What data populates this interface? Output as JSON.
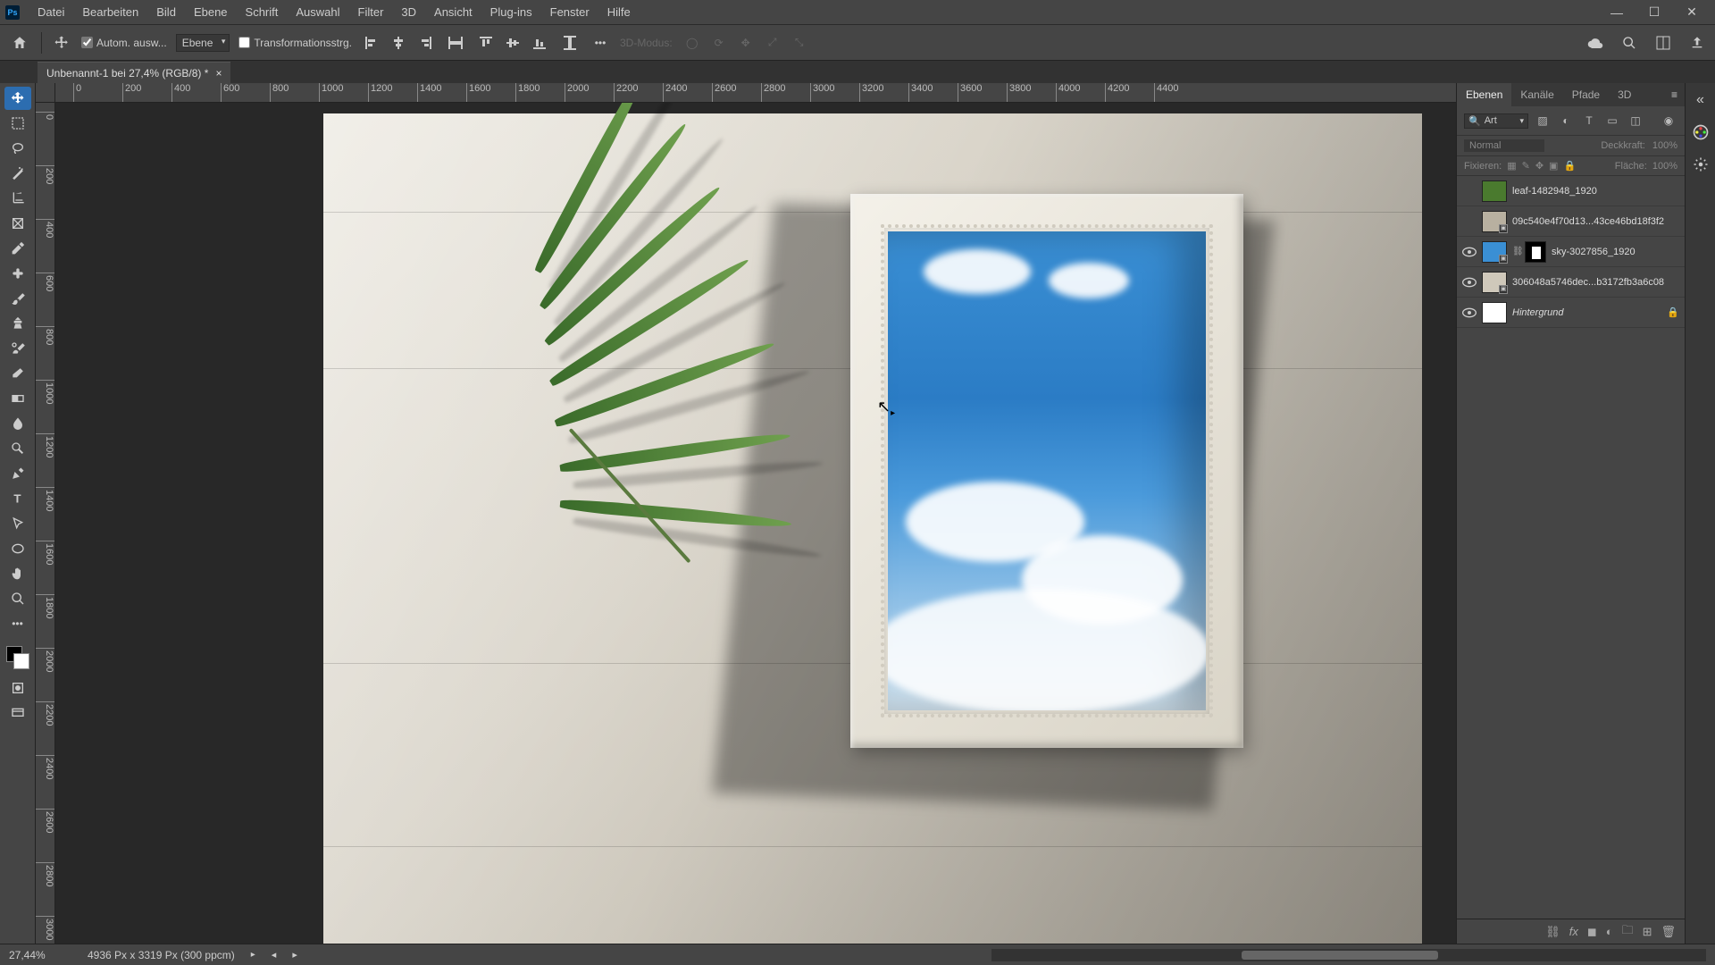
{
  "menubar": {
    "items": [
      "Datei",
      "Bearbeiten",
      "Bild",
      "Ebene",
      "Schrift",
      "Auswahl",
      "Filter",
      "3D",
      "Ansicht",
      "Plug-ins",
      "Fenster",
      "Hilfe"
    ]
  },
  "optionsbar": {
    "auto_select_label": "Autom. ausw...",
    "layer_dropdown": "Ebene",
    "transform_label": "Transformationsstrg.",
    "mode_3d_label": "3D-Modus:"
  },
  "doctab": {
    "title": "Unbenannt-1 bei 27,4% (RGB/8) *"
  },
  "ruler_h": [
    "0",
    "200",
    "400",
    "600",
    "800",
    "1000",
    "1200",
    "1400",
    "1600",
    "1800",
    "2000",
    "2200",
    "2400",
    "2600",
    "2800",
    "3000",
    "3200",
    "3400",
    "3600",
    "3800",
    "4000",
    "4200",
    "4400"
  ],
  "ruler_v": [
    "0",
    "200",
    "400",
    "600",
    "800",
    "1000",
    "1200",
    "1400",
    "1600",
    "1800",
    "2000",
    "2200",
    "2400",
    "2600",
    "2800",
    "3000"
  ],
  "panels": {
    "tabs": [
      "Ebenen",
      "Kanäle",
      "Pfade",
      "3D"
    ],
    "search_label": "Art",
    "blend_mode": "Normal",
    "opacity_label": "Deckkraft:",
    "opacity_value": "100%",
    "lock_label": "Fixieren:",
    "fill_label": "Fläche:",
    "fill_value": "100%"
  },
  "layers": [
    {
      "visible": false,
      "name": "leaf-1482948_1920",
      "thumb": "#4a7a2e",
      "mask": false,
      "smart": false,
      "italic": false
    },
    {
      "visible": false,
      "name": "09c540e4f70d13...43ce46bd18f3f2",
      "thumb": "#b8b0a0",
      "mask": false,
      "smart": true,
      "italic": false
    },
    {
      "visible": true,
      "name": "sky-3027856_1920",
      "thumb": "#3a8fd4",
      "mask": true,
      "smart": true,
      "italic": false
    },
    {
      "visible": true,
      "name": "306048a5746dec...b3172fb3a6c08",
      "thumb": "#cfc8ba",
      "mask": false,
      "smart": true,
      "italic": false
    },
    {
      "visible": true,
      "name": "Hintergrund",
      "thumb": "#ffffff",
      "mask": false,
      "smart": false,
      "italic": true,
      "locked": true
    }
  ],
  "statusbar": {
    "zoom": "27,44%",
    "doc_info": "4936 Px x 3319 Px (300 ppcm)"
  }
}
